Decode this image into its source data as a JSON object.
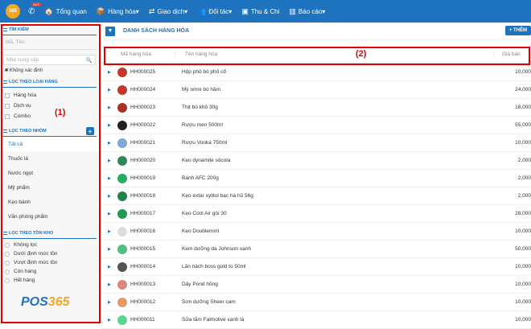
{
  "topbar": {
    "logo_text": "365",
    "phone_badge": "24/7",
    "nav": [
      {
        "icon": "home-icon",
        "glyph": "🏠",
        "label": "Tổng quan",
        "caret": false
      },
      {
        "icon": "box-icon",
        "glyph": "📦",
        "label": "Hàng hóa",
        "caret": true
      },
      {
        "icon": "exchange-icon",
        "glyph": "⇄",
        "label": "Giao dịch",
        "caret": true
      },
      {
        "icon": "users-icon",
        "glyph": "👥",
        "label": "Đối tác",
        "caret": true
      },
      {
        "icon": "cash-icon",
        "glyph": "▣",
        "label": "Thu & Chi",
        "caret": false
      },
      {
        "icon": "chart-icon",
        "glyph": "▥",
        "label": "Báo cáo",
        "caret": true
      }
    ]
  },
  "sidebar": {
    "search_title": "TÌM KIẾM",
    "search_placeholder": "Mã, Tên",
    "supplier_placeholder": "Nhà cung cấp",
    "supplier_unknown": "Không xác định",
    "type_title": "LỌC THEO LOẠI HÀNG",
    "types": [
      "Hàng hóa",
      "Dịch vụ",
      "Combo"
    ],
    "group_title": "LỌC THEO NHÓM",
    "groups": [
      "Tất cả",
      "Thuốc lá",
      "Nước ngọt",
      "Mỹ phẩm",
      "Kẹo bánh",
      "Văn phòng phẩm"
    ],
    "stock_title": "LỌC THEO TỒN KHO",
    "stock": [
      "Không lọc",
      "Dưới định mức tồn",
      "Vượt định mức tồn",
      "Còn hàng",
      "Hết hàng"
    ]
  },
  "main": {
    "title": "DANH SÁCH HÀNG HÓA",
    "add_label": "+ THÊM",
    "columns": {
      "code": "Mã hàng hóa",
      "name": "Tên hàng hóa",
      "price": "Giá bán"
    },
    "rows": [
      {
        "code": "HH000025",
        "name": "Hộp phô bò phố cổ",
        "price": "10,000",
        "color": "#c0392b"
      },
      {
        "code": "HH000024",
        "name": "Mỳ omni bò hầm",
        "price": "24,000",
        "color": "#c0392b"
      },
      {
        "code": "HH000023",
        "name": "Thịt bò khô 30g",
        "price": "18,000",
        "color": "#a93226"
      },
      {
        "code": "HH000022",
        "name": "Rượu men 500ml",
        "price": "55,000",
        "color": "#222222"
      },
      {
        "code": "HH000021",
        "name": "Rượu Vooka 750ml",
        "price": "10,000",
        "color": "#7fa7d9"
      },
      {
        "code": "HH000020",
        "name": "Kẹo dynamite sôcola",
        "price": "2,000",
        "color": "#2e8b57"
      },
      {
        "code": "HH000019",
        "name": "Bánh AFC 200g",
        "price": "2,000",
        "color": "#27ae60"
      },
      {
        "code": "HH000018",
        "name": "Kẹo extar xylitol bạc hà hũ 56g",
        "price": "2,000",
        "color": "#1e8449"
      },
      {
        "code": "HH000017",
        "name": "Kẹo Cool Air gói 30",
        "price": "28,000",
        "color": "#229954"
      },
      {
        "code": "HH000016",
        "name": "Kẹo Doublemint",
        "price": "10,000",
        "color": "#dddddd"
      },
      {
        "code": "HH000015",
        "name": "Kem dưỡng da Johnson xanh",
        "price": "50,000",
        "color": "#52be80"
      },
      {
        "code": "HH000014",
        "name": "Lăn nách boss gold to 50ml",
        "price": "10,000",
        "color": "#555555"
      },
      {
        "code": "HH000013",
        "name": "Dây Pond hồng",
        "price": "10,000",
        "color": "#d98880"
      },
      {
        "code": "HH000012",
        "name": "Sơn dưỡng Sheer cam",
        "price": "10,000",
        "color": "#e59866"
      },
      {
        "code": "HH000011",
        "name": "Sữa tắm Falmolive xanh lá",
        "price": "10,000",
        "color": "#58d68d"
      }
    ]
  },
  "annotations": {
    "label1": "(1)",
    "label2": "(2)"
  },
  "brand": {
    "pos": "POS",
    "num": "365"
  }
}
